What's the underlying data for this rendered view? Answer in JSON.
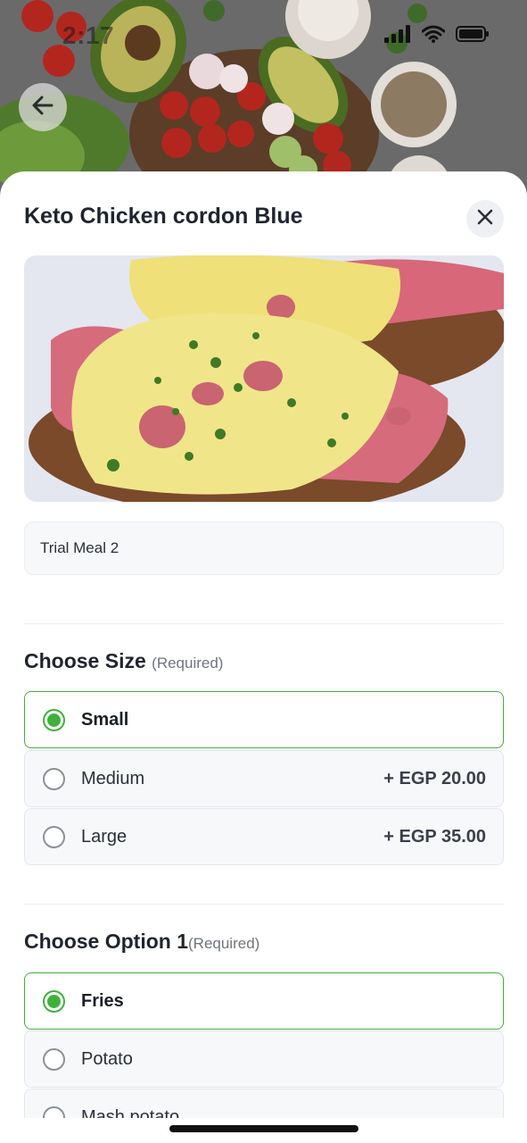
{
  "status_bar": {
    "time": "2:17",
    "icons": [
      "signal-icon",
      "wifi-icon",
      "battery-icon"
    ]
  },
  "header": {
    "back_icon": "arrow-left-icon"
  },
  "sheet": {
    "title": "Keto Chicken cordon Blue",
    "close_icon": "close-icon",
    "description": "Trial Meal 2"
  },
  "sections": [
    {
      "title": "Choose Size",
      "required_label": "(Required)",
      "options": [
        {
          "label": "Small",
          "price": "",
          "selected": true
        },
        {
          "label": "Medium",
          "price": "+ EGP 20.00",
          "selected": false
        },
        {
          "label": "Large",
          "price": "+ EGP 35.00",
          "selected": false
        }
      ]
    },
    {
      "title": "Choose Option 1",
      "required_label": "(Required)",
      "options": [
        {
          "label": "Fries",
          "price": "",
          "selected": true
        },
        {
          "label": "Potato",
          "price": "",
          "selected": false
        },
        {
          "label": "Mash potato",
          "price": "",
          "selected": false
        }
      ]
    }
  ],
  "colors": {
    "accent_green": "#3fb13b",
    "title_text": "#1f2430",
    "option_bg": "#f7f8fa"
  }
}
